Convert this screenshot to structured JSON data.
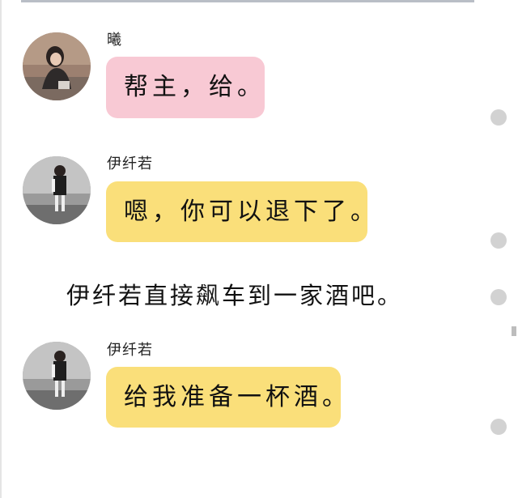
{
  "messages": [
    {
      "sender": "曦",
      "text": "帮主，给。",
      "bubble_color": "#f8c9d4",
      "avatar": "avatar-girl-sitting"
    },
    {
      "sender": "伊纤若",
      "text": "嗯，你可以退下了。",
      "bubble_color": "#fadf7a",
      "avatar": "avatar-girl-standing"
    },
    {
      "narration": "伊纤若直接飙车到一家酒吧。"
    },
    {
      "sender": "伊纤若",
      "text": "给我准备一杯酒。",
      "bubble_color": "#fadf7a",
      "avatar": "avatar-girl-standing"
    }
  ],
  "colors": {
    "bubble_pink": "#f8c9d4",
    "bubble_yellow": "#fadf7a",
    "dot": "#d2d2d2"
  }
}
